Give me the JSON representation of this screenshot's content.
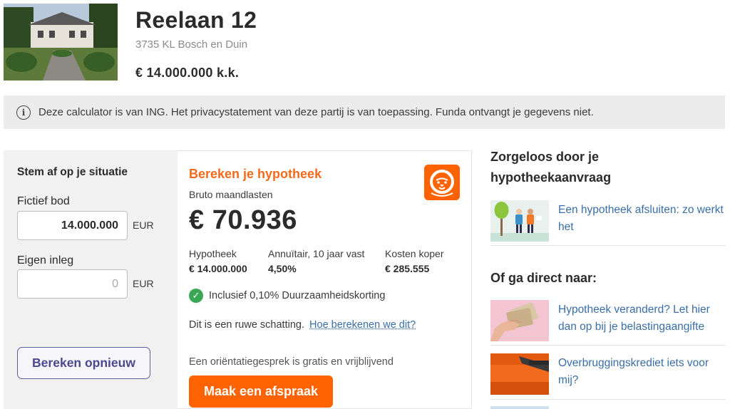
{
  "listing": {
    "title": "Reelaan 12",
    "address": "3735 KL Bosch en Duin",
    "price": "€ 14.000.000 k.k."
  },
  "info_banner": {
    "icon": "info-icon",
    "icon_glyph": "i",
    "text": "Deze calculator is van ING. Het privacystatement van deze partij is van toepassing. Funda ontvangt je gegevens niet."
  },
  "left_panel": {
    "heading": "Stem af op je situatie",
    "bid": {
      "label": "Fictief bod",
      "value": "14.000.000",
      "unit": "EUR"
    },
    "savings": {
      "label": "Eigen inleg",
      "placeholder": "0",
      "unit": "EUR"
    },
    "recalc_button": "Bereken opnieuw"
  },
  "calculator": {
    "heading": "Bereken je hypotheek",
    "logo_icon": "ing-lion-logo-icon",
    "subheading": "Bruto maandlasten",
    "monthly_amount": "€ 70.936",
    "stats": [
      {
        "label": "Hypotheek",
        "value": "€ 14.000.000"
      },
      {
        "label": "Annuïtair, 10 jaar vast",
        "value": "4,50%"
      },
      {
        "label": "Kosten koper",
        "value": "€ 285.555"
      }
    ],
    "discount": {
      "icon": "check-circle-icon",
      "glyph": "✓",
      "text": "Inclusief 0,10% Duurzaamheidskorting"
    },
    "estimate": {
      "text": "Dit is een ruwe schatting.",
      "link": "Hoe berekenen we dit?"
    },
    "orientation_text": "Een oriëntatiegesprek is gratis en vrijblijvend",
    "appointment_button": "Maak een afspraak"
  },
  "sidebar": {
    "heading_1": "Zorgeloos door je hypotheekaanvraag",
    "heading_1_line1": "Zorgeloos door je",
    "heading_1_line2": "hypotheekaanvraag",
    "article_1": "Een hypotheek afsluiten: zo werkt het",
    "heading_2": "Of ga direct naar:",
    "articles": [
      "Hypotheek veranderd? Let hier dan op bij je belastingaangifte",
      "Overbruggingskrediet iets voor mij?"
    ]
  },
  "colors": {
    "ing_orange": "#ff6200",
    "link_blue": "#3a6ea5",
    "button_purple": "#4a4990",
    "success_green": "#3aa754"
  }
}
